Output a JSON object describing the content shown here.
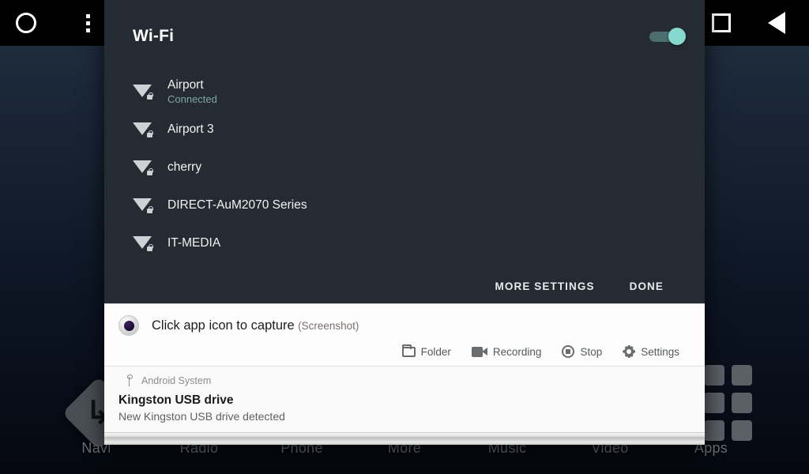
{
  "system_nav": {
    "home_icon": "home-circle-icon",
    "overflow_icon": "overflow-menu-icon",
    "recents_icon": "square-recents-icon",
    "back_icon": "back-triangle-icon"
  },
  "launcher": {
    "dock_labels": [
      "Navi",
      "Radio",
      "Phone",
      "More",
      "Music",
      "Video",
      "Apps"
    ],
    "nav_widget_icon": "turn-arrow-icon",
    "apps_grid_icon": "apps-grid-icon"
  },
  "wifi_panel": {
    "title": "Wi-Fi",
    "toggle": {
      "state": "on",
      "accent": "#86d9cf",
      "track": "#4d6e6e"
    },
    "networks": [
      {
        "name": "Airport",
        "status": "Connected",
        "secured": true,
        "signal": "strong"
      },
      {
        "name": "Airport 3",
        "status": "",
        "secured": true,
        "signal": "strong"
      },
      {
        "name": "cherry",
        "status": "",
        "secured": true,
        "signal": "strong"
      },
      {
        "name": "DIRECT-AuM2070 Series",
        "status": "",
        "secured": true,
        "signal": "strong"
      },
      {
        "name": "IT-MEDIA",
        "status": "",
        "secured": true,
        "signal": "strong"
      }
    ],
    "buttons": {
      "more_settings": "MORE SETTINGS",
      "done": "DONE"
    },
    "colors": {
      "background": "#252b33",
      "connected_text": "#7fa6a3"
    }
  },
  "capture_notification": {
    "icon": "screenshot-record-icon",
    "title": "Click app icon to capture",
    "subtitle": "(Screenshot)",
    "actions": [
      {
        "label": "Folder",
        "icon": "folder-icon"
      },
      {
        "label": "Recording",
        "icon": "video-camera-icon"
      },
      {
        "label": "Stop",
        "icon": "stop-circle-icon"
      },
      {
        "label": "Settings",
        "icon": "gear-icon"
      }
    ]
  },
  "usb_notification": {
    "app": "Android System",
    "app_icon": "usb-icon",
    "title": "Kingston USB drive",
    "body": "New Kingston USB drive detected"
  }
}
